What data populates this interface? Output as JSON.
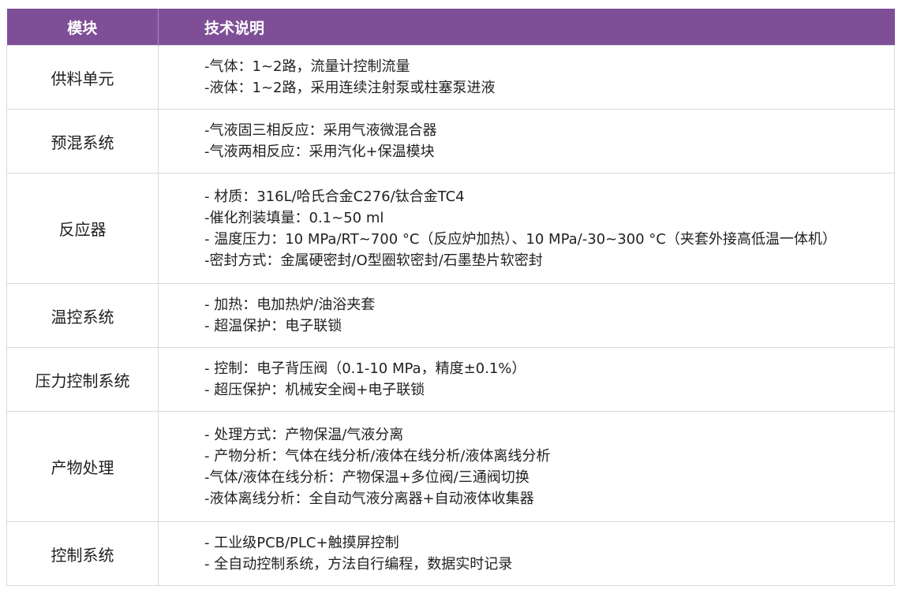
{
  "header": {
    "module": "模块",
    "description": "技术说明"
  },
  "rows": [
    {
      "module": "供料单元",
      "lines": [
        "-气体：1~2路，流量计控制流量",
        "-液体：1~2路，采用连续注射泵或柱塞泵进液"
      ]
    },
    {
      "module": "预混系统",
      "lines": [
        "-气液固三相反应：采用气液微混合器",
        "-气液两相反应：采用汽化+保温模块"
      ]
    },
    {
      "module": "反应器",
      "lines": [
        "- 材质：316L/哈氏合金C276/钛合金TC4",
        "-催化剂装填量：0.1~50 ml",
        "- 温度压力：10 MPa/RT~700 °C（反应炉加热）、10 MPa/-30~300 °C（夹套外接高低温一体机）",
        "-密封方式：金属硬密封/O型圈软密封/石墨垫片软密封"
      ]
    },
    {
      "module": "温控系统",
      "lines": [
        "- 加热：电加热炉/油浴夹套",
        "- 超温保护：电子联锁"
      ]
    },
    {
      "module": "压力控制系统",
      "lines": [
        "- 控制：电子背压阀（0.1-10 MPa，精度±0.1%）",
        "- 超压保护：机械安全阀+电子联锁"
      ]
    },
    {
      "module": "产物处理",
      "lines": [
        "- 处理方式：产物保温/气液分离",
        "- 产物分析：气体在线分析/液体在线分析/液体离线分析",
        "-气体/液体在线分析：产物保温+多位阀/三通阀切换",
        "-液体离线分析：全自动气液分离器+自动液体收集器"
      ]
    },
    {
      "module": "控制系统",
      "lines": [
        "- 工业级PCB/PLC+触摸屏控制",
        "- 全自动控制系统，方法自行编程，数据实时记录"
      ]
    }
  ],
  "colors": {
    "header_bg": "#7e4f97",
    "header_text": "#ffffff",
    "grid": "#d9d9d9"
  }
}
